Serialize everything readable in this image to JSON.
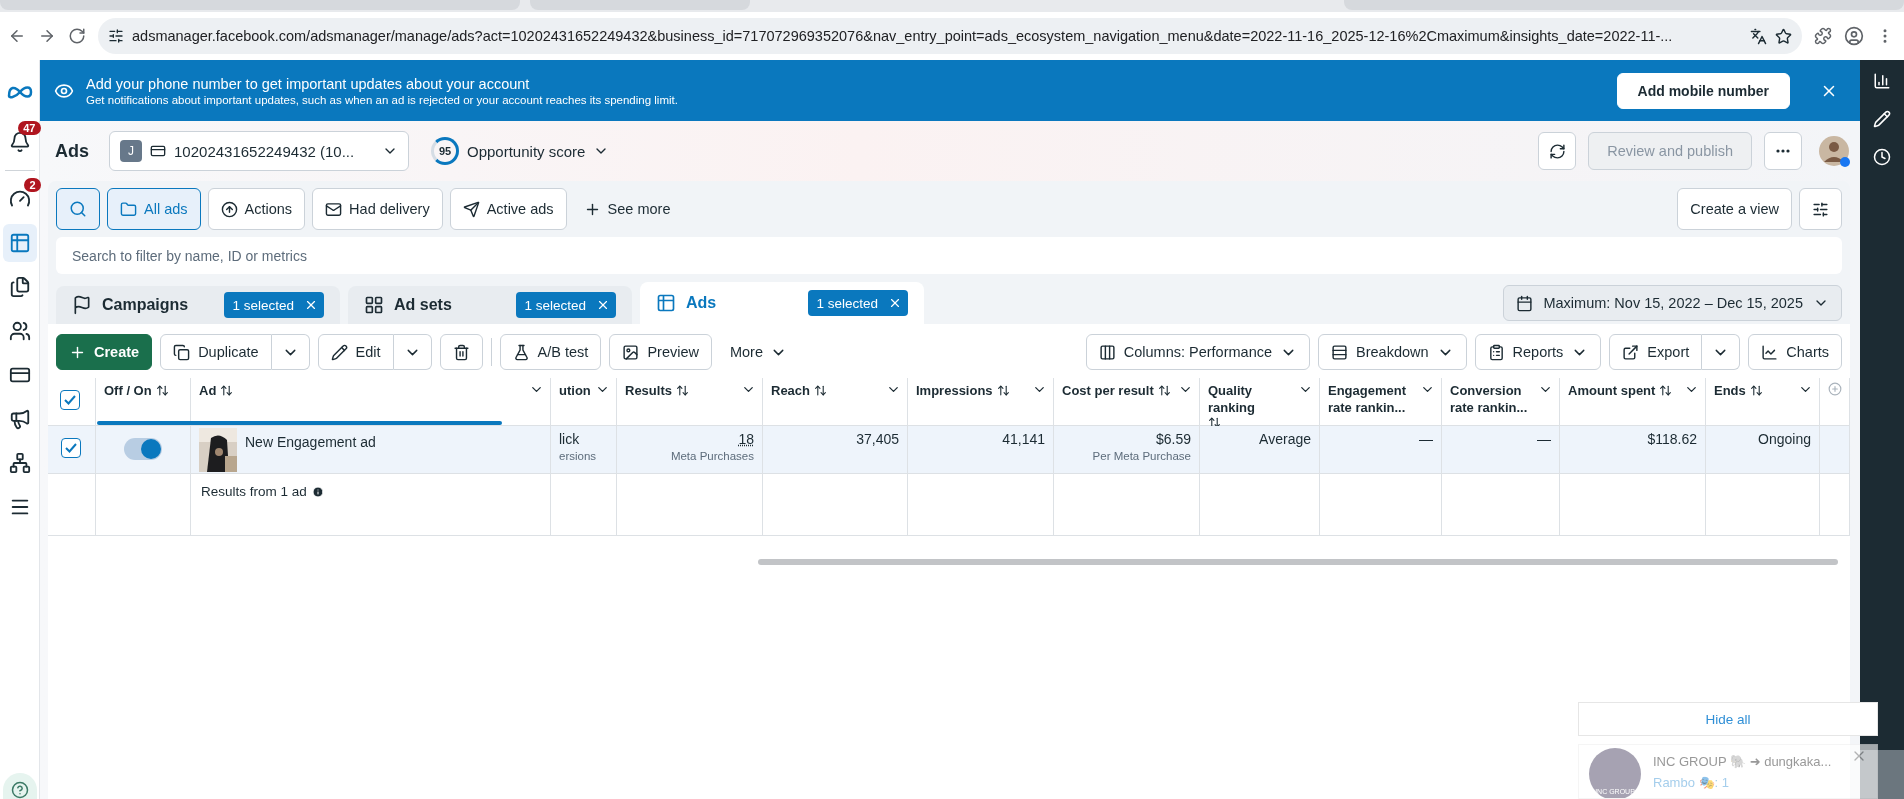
{
  "browser": {
    "url": "adsmanager.facebook.com/adsmanager/manage/ads?act=10202431652249432&business_id=717072969352076&nav_entry_point=ads_ecosystem_navigation_menu&date=2022-11-16_2025-12-16%2Cmaximum&insights_date=2022-11-..."
  },
  "banner": {
    "title": "Add your phone number to get important updates about your account",
    "text": "Get notifications about important updates, such as when an ad is rejected or your account reaches its spending limit.",
    "button": "Add mobile number"
  },
  "sidebar": {
    "items": [
      {
        "kind": "bell",
        "badge": "47",
        "selected": false
      },
      {
        "kind": "gauge",
        "badge": "2",
        "selected": false
      },
      {
        "kind": "table",
        "selected": true
      },
      {
        "kind": "pages",
        "selected": false
      },
      {
        "kind": "people",
        "selected": false
      },
      {
        "kind": "card",
        "selected": false
      },
      {
        "kind": "megaphone",
        "selected": false
      },
      {
        "kind": "network",
        "selected": false
      },
      {
        "kind": "menu",
        "selected": false
      }
    ]
  },
  "header": {
    "title": "Ads",
    "account_initial": "J",
    "account": "10202431652249432 (10...",
    "score": "95",
    "score_label": "Opportunity score",
    "review_button": "Review and publish"
  },
  "filters": {
    "items": [
      {
        "kind": "folder",
        "label": "All ads",
        "selected": true
      },
      {
        "kind": "actions",
        "label": "Actions",
        "selected": false
      },
      {
        "kind": "mail",
        "label": "Had delivery",
        "selected": false
      },
      {
        "kind": "send",
        "label": "Active ads",
        "selected": false
      }
    ],
    "see_more": "See more",
    "create_view": "Create a view"
  },
  "search": {
    "placeholder": "Search to filter by name, ID or metrics"
  },
  "levels": {
    "tabs": [
      {
        "kind": "campaign",
        "label": "Campaigns",
        "badge": "1 selected",
        "selected": false
      },
      {
        "kind": "adset",
        "label": "Ad sets",
        "badge": "1 selected",
        "selected": false
      },
      {
        "kind": "ad",
        "label": "Ads",
        "badge": "1 selected",
        "selected": true
      }
    ],
    "date_range": "Maximum: Nov 15, 2022 – Dec 15, 2025"
  },
  "toolbar": {
    "create": "Create",
    "duplicate": "Duplicate",
    "edit": "Edit",
    "ab_test": "A/B test",
    "preview": "Preview",
    "more": "More",
    "columns": "Columns: Performance",
    "breakdown": "Breakdown",
    "reports": "Reports",
    "export": "Export",
    "charts": "Charts"
  },
  "table": {
    "columns": [
      {
        "kind": "check",
        "checked": true
      },
      {
        "kind": "toggle",
        "label": "Off / On",
        "sortable": true
      },
      {
        "kind": "name",
        "label": "Ad",
        "sortable": true
      },
      {
        "kind": "text",
        "label": "ution",
        "sortable": false
      },
      {
        "kind": "number",
        "label": "Results",
        "sortable": true
      },
      {
        "kind": "number",
        "label": "Reach",
        "sortable": true
      },
      {
        "kind": "number",
        "label": "Impressions",
        "sortable": true
      },
      {
        "kind": "number",
        "label": "Cost per result",
        "sortable": true
      },
      {
        "kind": "number",
        "label": "Quality ranking",
        "sortable": true
      },
      {
        "kind": "number",
        "label": "Engagement rate rankin...",
        "sortable": false
      },
      {
        "kind": "number",
        "label": "Conversion rate rankin...",
        "sortable": false
      },
      {
        "kind": "number",
        "label": "Amount spent",
        "sortable": true
      },
      {
        "kind": "number",
        "label": "Ends",
        "sortable": true
      }
    ],
    "rows": [
      {
        "cells": [
          {
            "checked": true
          },
          {
            "on": true
          },
          {
            "value": "New Engagement ad"
          },
          {
            "value": "lick",
            "sub": "ersions"
          },
          {
            "value": "18",
            "sub": "Meta Purchases"
          },
          {
            "value": "37,405"
          },
          {
            "value": "41,141"
          },
          {
            "value": "$6.59",
            "sub": "Per Meta Purchase"
          },
          {
            "value": "Average"
          },
          {
            "value": "—"
          },
          {
            "value": "—"
          },
          {
            "value": "$118.62"
          },
          {
            "value": "Ongoing"
          }
        ]
      }
    ],
    "summary": "Results from 1 ad"
  },
  "notifications": {
    "hide_all": "Hide all",
    "items": [
      {
        "avatar_text": "INC GROUP",
        "title": "INC GROUP 🐘 ➜ dungkaka...",
        "text": "Rambo 🎭: 1"
      }
    ]
  }
}
